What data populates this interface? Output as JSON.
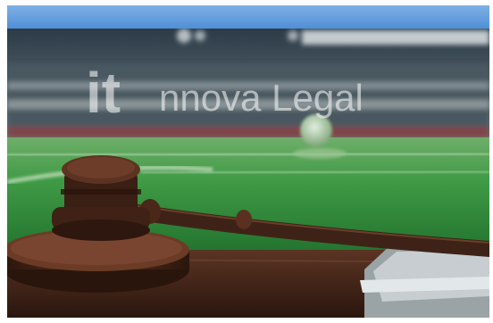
{
  "watermark": {
    "logo_text": "it",
    "text": "nnova Legal"
  },
  "scene": {
    "objects": [
      "gavel",
      "sound-block",
      "wooden-table",
      "soccer-stadium",
      "soccer-ball",
      "open-laptop"
    ]
  },
  "colors": {
    "frame_top_bar": "#4f8fd6",
    "grass": "#2e8a3a",
    "wood": "#4a2a1c"
  }
}
